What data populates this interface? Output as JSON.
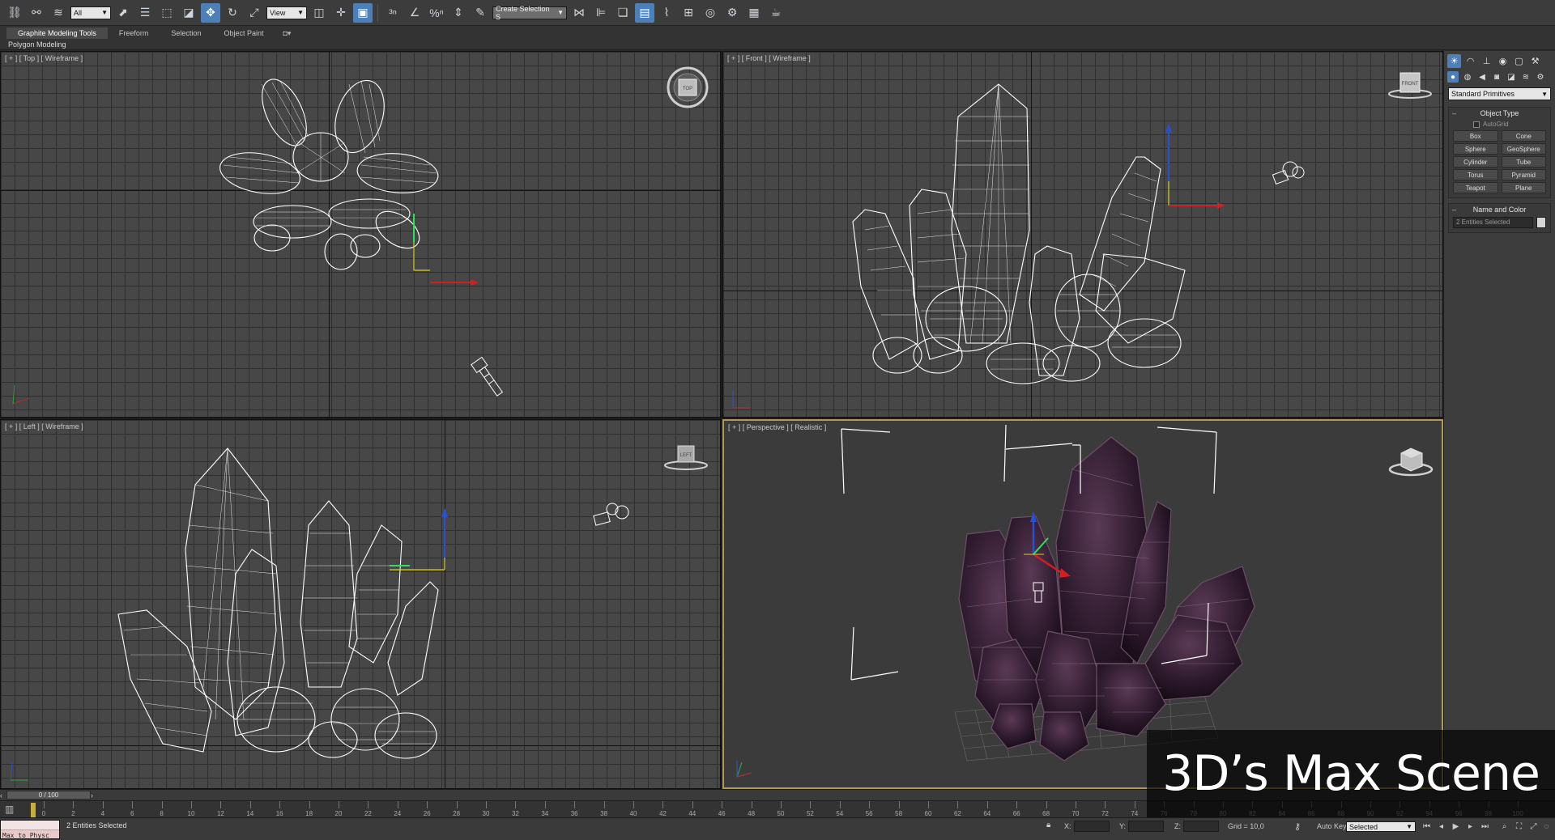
{
  "toolbar": {
    "selection_filter": "All",
    "reference_coord": "View",
    "named_selection": "Create Selection S"
  },
  "ribbon": {
    "tabs": [
      "Graphite Modeling Tools",
      "Freeform",
      "Selection",
      "Object Paint"
    ],
    "active_tab": "Graphite Modeling Tools",
    "sub_label": "Polygon Modeling"
  },
  "viewports": {
    "top": {
      "label": "[ + ] [ Top ] [ Wireframe ]",
      "viewcube": "TOP"
    },
    "front": {
      "label": "[ + ] [ Front ] [ Wireframe ]",
      "viewcube": "FRONT"
    },
    "left": {
      "label": "[ + ] [ Left ] [ Wireframe ]",
      "viewcube": "LEFT"
    },
    "perspective": {
      "label": "[ + ] [ Perspective ] [ Realistic ]"
    }
  },
  "command_panel": {
    "dropdown": "Standard Primitives",
    "object_type": {
      "title": "Object Type",
      "autogrid": "AutoGrid",
      "buttons": [
        "Box",
        "Cone",
        "Sphere",
        "GeoSphere",
        "Cylinder",
        "Tube",
        "Torus",
        "Pyramid",
        "Teapot",
        "Plane"
      ]
    },
    "name_and_color": {
      "title": "Name and Color",
      "field": "2 Entities Selected"
    }
  },
  "timeline": {
    "slider": "0 / 100",
    "ticks": [
      "0",
      "2",
      "4",
      "6",
      "8",
      "10",
      "12",
      "14",
      "16",
      "18",
      "20",
      "22",
      "24",
      "26",
      "28",
      "30",
      "32",
      "34",
      "36",
      "38",
      "40",
      "42",
      "44",
      "46",
      "48",
      "50",
      "52",
      "54",
      "56",
      "58",
      "60",
      "62",
      "64",
      "66",
      "68",
      "70",
      "72",
      "74",
      "76",
      "78",
      "80",
      "82",
      "84",
      "86",
      "88",
      "90",
      "92",
      "94",
      "96",
      "98",
      "100"
    ]
  },
  "status": {
    "maxscript": "Max to Physc",
    "selection": "2 Entities Selected",
    "x_label": "X:",
    "y_label": "Y:",
    "z_label": "Z:",
    "grid": "Grid = 10,0",
    "auto_key": "Auto Key",
    "selected": "Selected"
  },
  "overlay_title": "3D’s Max Scene",
  "colors": {
    "accent": "#4d7fb8",
    "active_viewport_border": "#b19a55",
    "crystal": "#3a2438",
    "wireframe": "#ffffff"
  }
}
